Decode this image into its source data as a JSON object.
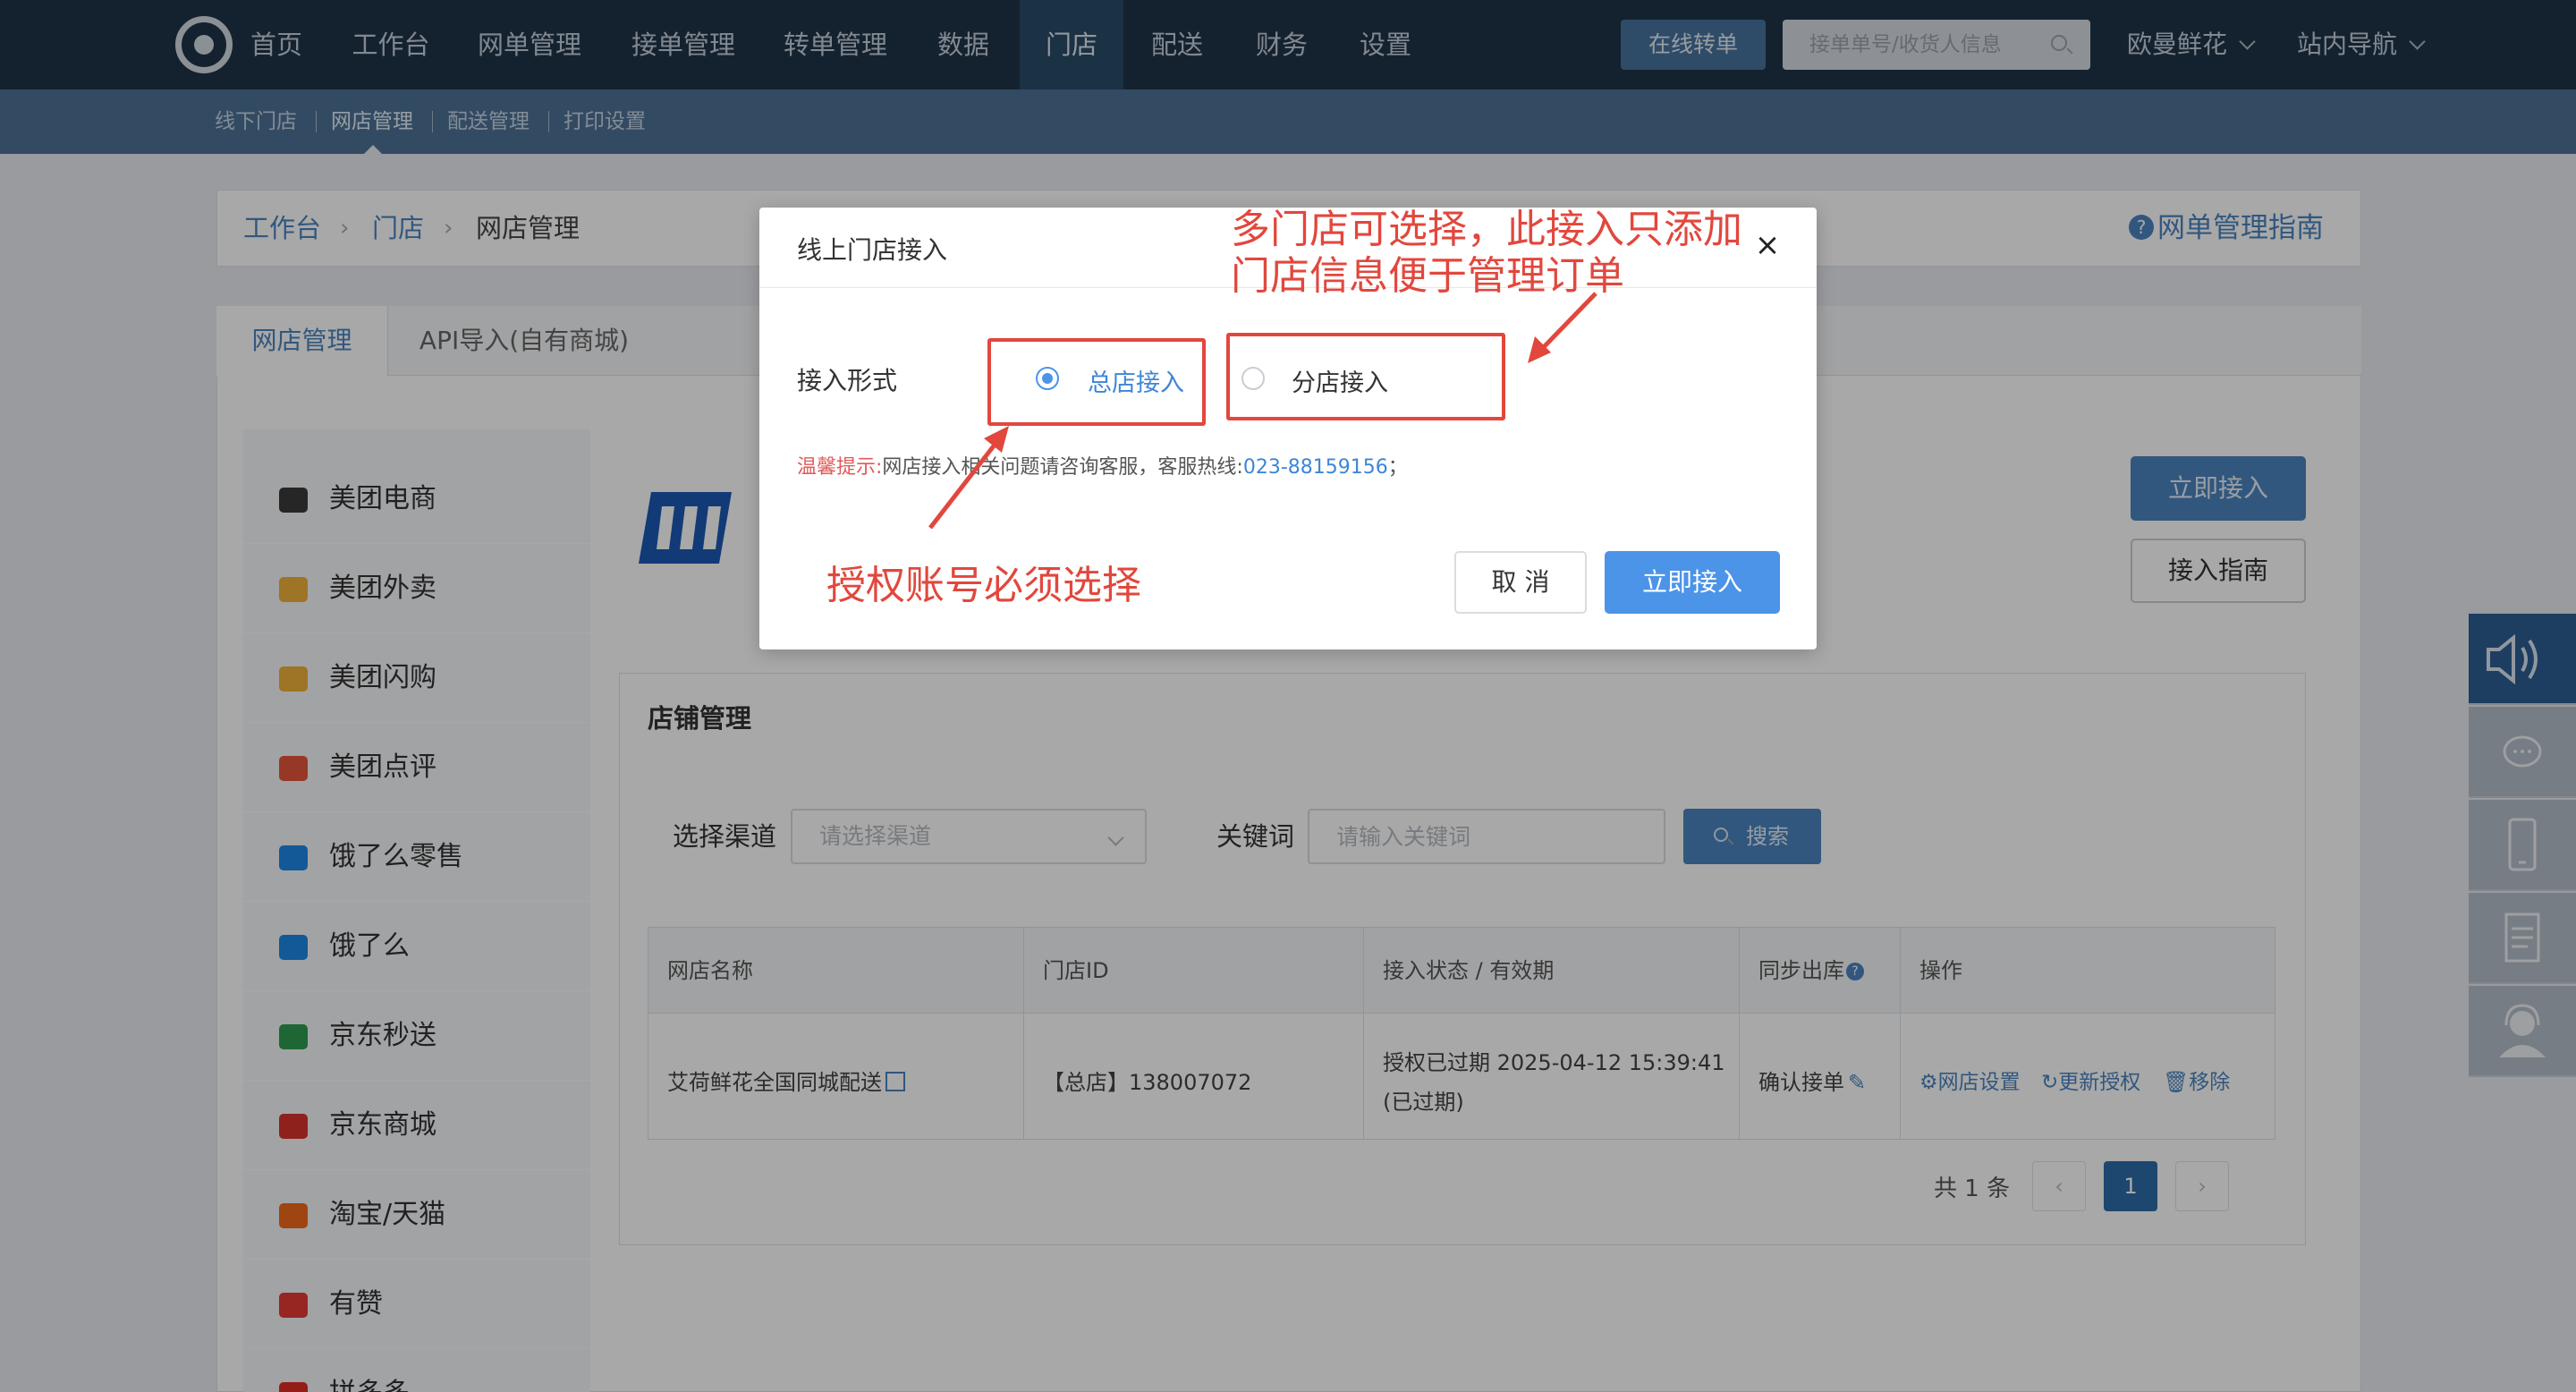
{
  "topnav": {
    "items": [
      "首页",
      "工作台",
      "网单管理",
      "接单管理",
      "转单管理",
      "数据",
      "门店",
      "配送",
      "财务",
      "设置"
    ],
    "active": "门店",
    "online_transfer": "在线转单",
    "search_placeholder": "接单单号/收货人信息",
    "shop_name": "欧曼鲜花",
    "site_nav": "站内导航"
  },
  "subnav": {
    "items": [
      "线下门店",
      "网店管理",
      "配送管理",
      "打印设置"
    ]
  },
  "breadcrumb": {
    "items": [
      "工作台",
      "门店",
      "网店管理"
    ],
    "guide_link": "网单管理指南",
    "guide_icon": "?"
  },
  "tabs": [
    "网店管理",
    "API导入(自有商城)"
  ],
  "sidebar": {
    "items": [
      {
        "label": "美团电商",
        "icon": "meituan-ecom-icon",
        "color": "#3a3a3a"
      },
      {
        "label": "美团外卖",
        "icon": "meituan-waimai-icon",
        "color": "#f0b03a"
      },
      {
        "label": "美团闪购",
        "icon": "meituan-shangou-icon",
        "color": "#f0b03a"
      },
      {
        "label": "美团点评",
        "icon": "dianping-icon",
        "color": "#e6553a"
      },
      {
        "label": "饿了么零售",
        "icon": "eleme-retail-icon",
        "color": "#1e88e5"
      },
      {
        "label": "饿了么",
        "icon": "eleme-icon",
        "color": "#1e88e5"
      },
      {
        "label": "京东秒送",
        "icon": "jd-miaosong-icon",
        "color": "#2e9d4f"
      },
      {
        "label": "京东商城",
        "icon": "jd-mall-icon",
        "color": "#d9332c"
      },
      {
        "label": "淘宝/天猫",
        "icon": "taobao-icon",
        "color": "#f06a1a"
      },
      {
        "label": "有赞",
        "icon": "youzan-icon",
        "color": "#e53935"
      },
      {
        "label": "拼多多",
        "icon": "pinduoduo-icon",
        "color": "#e02e24"
      }
    ]
  },
  "actions": {
    "connect_now": "立即接入",
    "connect_guide": "接入指南"
  },
  "store": {
    "title": "店铺管理",
    "channel_label": "选择渠道",
    "channel_placeholder": "请选择渠道",
    "keyword_label": "关键词",
    "keyword_placeholder": "请输入关键词",
    "search_button": "搜索",
    "columns": [
      "网店名称",
      "门店ID",
      "接入状态 / 有效期",
      "同步出库",
      "操作"
    ],
    "rows": [
      {
        "name": "艾荷鲜花全国同城配送",
        "store_id": "【总店】138007072",
        "status_line1": "授权已过期 2025-04-12 15:39:41",
        "status_line2": "(已过期)",
        "sync": "确认接单",
        "ops": [
          "网店设置",
          "更新授权",
          "移除"
        ]
      }
    ],
    "total": "共 1 条",
    "page_prev": "‹",
    "page_current": "1",
    "page_next": "›"
  },
  "modal": {
    "title": "线上门店接入",
    "close": "×",
    "mode_label": "接入形式",
    "option_main": "总店接入",
    "option_branch": "分店接入",
    "selected": "总店接入",
    "tip_prefix": "温馨提示:",
    "tip_text": "网店接入相关问题请咨询客服，客服热线:",
    "tip_phone": "023-88159156",
    "tip_suffix": "；",
    "cancel": "取 消",
    "confirm": "立即接入"
  },
  "annotations": {
    "top_line1": "多门店可选择，此接入只添加",
    "top_line2": "门店信息便于管理订单",
    "bottom": "授权账号必须选择",
    "color": "#e2473d"
  },
  "float_bar": [
    "sound-icon",
    "chat-icon",
    "phone-icon",
    "document-icon",
    "service-agent-icon"
  ]
}
